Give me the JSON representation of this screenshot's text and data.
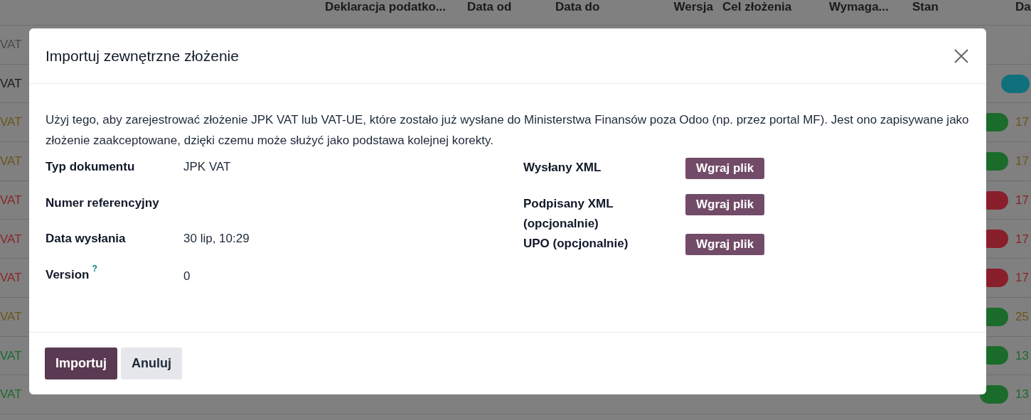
{
  "list": {
    "columns": [
      {
        "label": "Deklaracja podatko..."
      },
      {
        "label": "Data od"
      },
      {
        "label": "Data do"
      },
      {
        "label": "Wersja"
      },
      {
        "label": "Cel złożenia"
      },
      {
        "label": "Wymaga..."
      },
      {
        "label": "Stan"
      },
      {
        "label": "Da"
      }
    ],
    "rows": [
      {
        "label": "VAT",
        "color": "#4a4a4a"
      },
      {
        "label": "VAT",
        "color": "#1a1a1a",
        "badge": {
          "color": "#10707c"
        }
      },
      {
        "label": "VAT",
        "color": "#6b5417",
        "date": "17",
        "badge": {
          "color": "#1b6b2b"
        }
      },
      {
        "label": "VAT",
        "color": "#6b5417",
        "date": "17",
        "badge": {
          "color": "#1b6b2b"
        }
      },
      {
        "label": "VAT",
        "color": "#8a2424",
        "date": "17",
        "badge": {
          "color": "#8a1f2c"
        }
      },
      {
        "label": "VAT",
        "color": "#8a2424",
        "date": "17",
        "badge": {
          "color": "#8a1f2c"
        }
      },
      {
        "label": "VAT",
        "color": "#8a2424",
        "date": "17",
        "badge": {
          "color": "#8a1f2c"
        }
      },
      {
        "label": "VAT",
        "color": "#6b5417",
        "date": "25",
        "badge": {
          "color": "#1b6b2b"
        }
      },
      {
        "label": "VAT",
        "color": "#1b6b2b",
        "date": "13",
        "badge": {
          "color": "#1b6b2b"
        }
      },
      {
        "label": "VAT",
        "color": "#1b6b2b",
        "date": "13",
        "badge": {
          "color": "#1b6b2b"
        }
      }
    ]
  },
  "dialog": {
    "title": "Importuj zewnętrzne złożenie",
    "description": "Użyj tego, aby zarejestrować złożenie JPK VAT lub VAT-UE, które zostało już wysłane do Ministerstwa Finansów poza Odoo (np. przez portal MF). Jest ono zapisywane jako złożenie zaakceptowane, dzięki czemu może służyć jako podstawa kolejnej korekty.",
    "fields": [
      {
        "label": "Typ dokumentu",
        "value": "JPK VAT"
      },
      {
        "label": "Numer referencyjny"
      },
      {
        "label": "Data wysłania",
        "value": "30 lip, 10:29"
      },
      {
        "label": "Version",
        "help": "?",
        "value": "0"
      }
    ],
    "uploads": [
      {
        "label": "Wysłany XML",
        "button": "Wgraj plik"
      },
      {
        "label": "Podpisany XML (opcjonalnie)",
        "button": "Wgraj plik"
      },
      {
        "label": "UPO (opcjonalnie)",
        "button": "Wgraj plik"
      }
    ],
    "buttons": [
      {
        "label": "Importuj",
        "kind": "primary"
      },
      {
        "label": "Anuluj",
        "kind": "secondary"
      }
    ]
  }
}
